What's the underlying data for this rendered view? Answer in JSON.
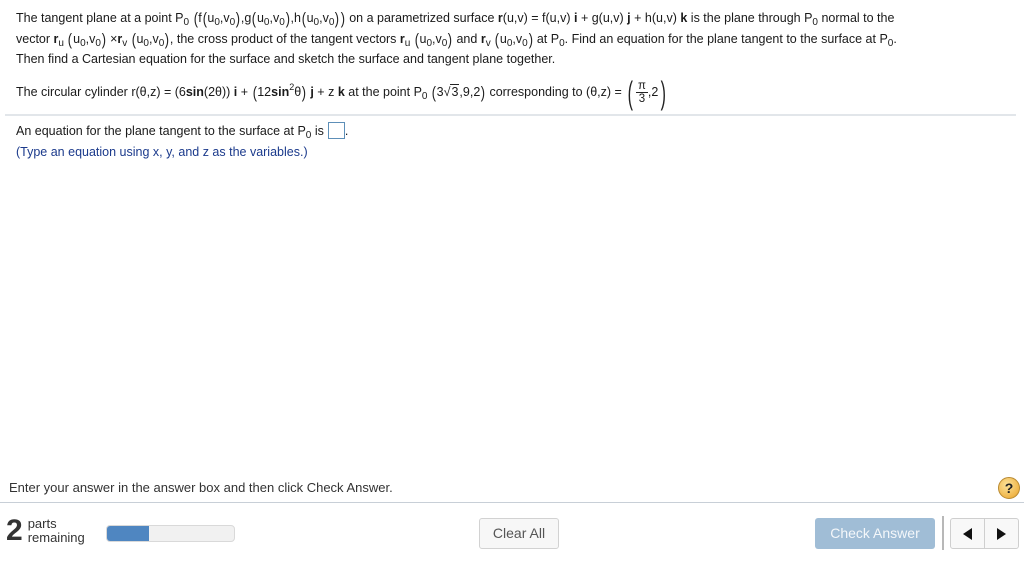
{
  "question": {
    "line1": {
      "t1": "The tangent plane at a point P",
      "sub0": "0",
      "t2": "f",
      "t3": "u",
      "t4": "v",
      "t5": "g",
      "t6": "h",
      "t7": "on a parametrized surface",
      "t8": "r",
      "t9": "(u,v) = f(u,v)",
      "t10": "i",
      "t11": "+ g(u,v)",
      "t12": "j",
      "t13": "+ h(u,v)",
      "t14": "k",
      "t15": "is the plane through P",
      "t16": "normal to the"
    },
    "line2": {
      "t1": "vector",
      "r": "r",
      "u": "u",
      "v": "v",
      "times": "×",
      "t2": ", the cross product of the tangent vectors",
      "and": "and",
      "t3": "at P",
      "t4": ". Find an equation for the plane tangent to the surface at P",
      "t5": "."
    },
    "line3": "Then find a Cartesian equation for the surface and sketch the surface and tangent plane together."
  },
  "problem": {
    "t1": "The circular cylinder r(θ,z) = (6",
    "sin": "sin",
    "t2": "(2θ))",
    "i": "i",
    "plus": "+",
    "t3": "12",
    "sin2": "sin",
    "sup2": "2",
    "theta": "θ",
    "j": "j",
    "t4": "+ z",
    "k": "k",
    "t5": "at the point P",
    "sub0": "0",
    "p1": "3",
    "p2": "3",
    "p3": ",9,2",
    "t6": "corresponding to (θ,z) =",
    "frac_num": "π",
    "frac_den": "3",
    "t7": ",2"
  },
  "answer": {
    "prompt": "An equation for the plane tangent to the surface at P",
    "sub0": "0",
    "is": "is",
    "period": ".",
    "value": "",
    "hint": "(Type an equation using x, y, and z as the variables.)"
  },
  "footer": {
    "instructions": "Enter your answer in the answer box and then click Check Answer.",
    "help_icon": "?",
    "parts_count": "2",
    "parts_label_1": "parts",
    "parts_label_2": "remaining",
    "progress_fraction": 0.33,
    "clear_all_label": "Clear All",
    "check_answer_label": "Check Answer"
  },
  "colors": {
    "accent": "#4f86c1",
    "check_disabled": "#a0bdd6",
    "hint_text": "#1b3a8c",
    "help_icon": "#f0b64a"
  }
}
